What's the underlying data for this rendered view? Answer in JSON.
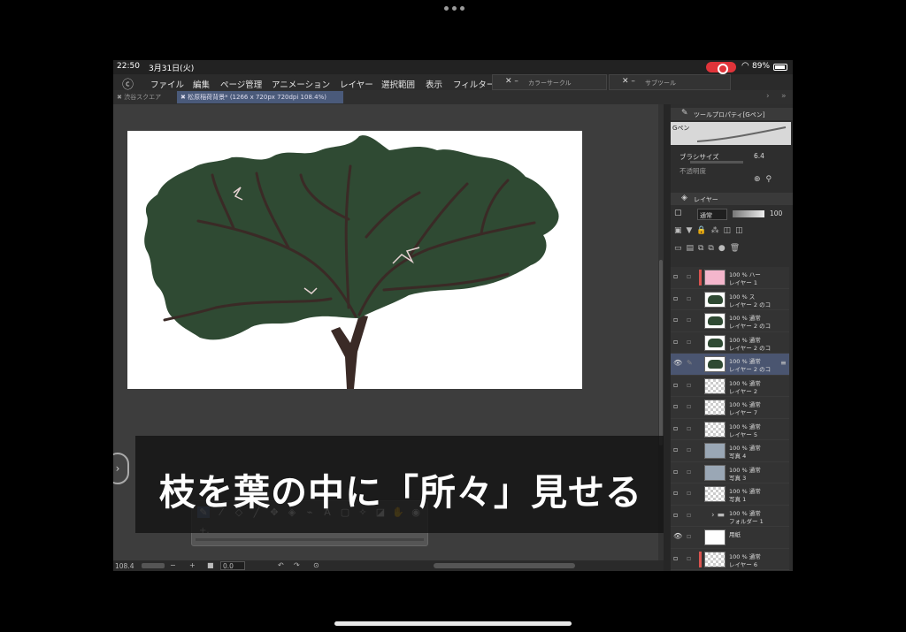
{
  "status": {
    "time": "22:50",
    "date": "3月31日(火)",
    "battery": "89%"
  },
  "menu": {
    "items": [
      "ファイル",
      "編集",
      "ページ管理",
      "アニメーション",
      "レイヤー",
      "選択範囲",
      "表示",
      "フィルター"
    ],
    "floating_color": "カラーサークル",
    "floating_sub": "サブツール"
  },
  "tabs": {
    "tab1": "渋谷スクエア",
    "tab2": "松原稲荷背景* (1266 x 720px 720dpi 108.4%)"
  },
  "tool_property": {
    "title": "ツールプロパティ[Gペン]",
    "brush_name": "Gペン",
    "brush_size_label": "ブラシサイズ",
    "brush_size_value": "6.4",
    "next_label": "不透明度"
  },
  "layer_panel": {
    "title": "レイヤー",
    "blend_mode": "通常",
    "opacity": "100",
    "layers": [
      {
        "line1": "100 % ハー",
        "line2": "レイヤー 1",
        "thumb": "pink",
        "accent": true,
        "selected": false,
        "visible": false
      },
      {
        "line1": "100 % ス",
        "line2": "レイヤー 2 のコ",
        "thumb": "tree",
        "accent": false,
        "selected": false,
        "visible": false
      },
      {
        "line1": "100 % 通常",
        "line2": "レイヤー 2 のコ",
        "thumb": "tree",
        "accent": false,
        "selected": false,
        "visible": false
      },
      {
        "line1": "100 % 通常",
        "line2": "レイヤー 2 のコ",
        "thumb": "tree",
        "accent": false,
        "selected": false,
        "visible": false
      },
      {
        "line1": "100 % 通常",
        "line2": "レイヤー 2 のコ",
        "thumb": "tree",
        "accent": false,
        "selected": true,
        "visible": true
      },
      {
        "line1": "100 % 通常",
        "line2": "レイヤー 2",
        "thumb": "checker",
        "accent": false,
        "selected": false,
        "visible": false
      },
      {
        "line1": "100 % 通常",
        "line2": "レイヤー 7",
        "thumb": "checker",
        "accent": false,
        "selected": false,
        "visible": false
      },
      {
        "line1": "100 % 通常",
        "line2": "レイヤー 5",
        "thumb": "checker",
        "accent": false,
        "selected": false,
        "visible": false
      },
      {
        "line1": "100 % 通常",
        "line2": "写真 4",
        "thumb": "photo",
        "accent": false,
        "selected": false,
        "visible": false
      },
      {
        "line1": "100 % 通常",
        "line2": "写真 3",
        "thumb": "photo",
        "accent": false,
        "selected": false,
        "visible": false
      },
      {
        "line1": "100 % 通常",
        "line2": "写真 1",
        "thumb": "checker",
        "accent": false,
        "selected": false,
        "visible": false
      },
      {
        "line1": "100 % 通常",
        "line2": "フォルダー 1",
        "thumb": "folder",
        "accent": false,
        "selected": false,
        "visible": false
      },
      {
        "line1": "用紙",
        "line2": "",
        "thumb": "white",
        "accent": false,
        "selected": false,
        "visible": true
      },
      {
        "line1": "100 % 通常",
        "line2": "レイヤー 6",
        "thumb": "checker",
        "accent": true,
        "selected": false,
        "visible": false
      }
    ]
  },
  "bottom": {
    "zoom": "108.4",
    "angle": "0.0"
  },
  "subtitle": "枝を葉の中に「所々」見せる",
  "colors": {
    "foliage": "#2f4a33",
    "branch": "#3a2a26",
    "selection": "#4a5570",
    "record": "#e0343a"
  },
  "icons": [
    "clip-studio-logo",
    "eye-icon",
    "pen-icon",
    "wifi-icon",
    "battery-icon",
    "record-icon"
  ]
}
